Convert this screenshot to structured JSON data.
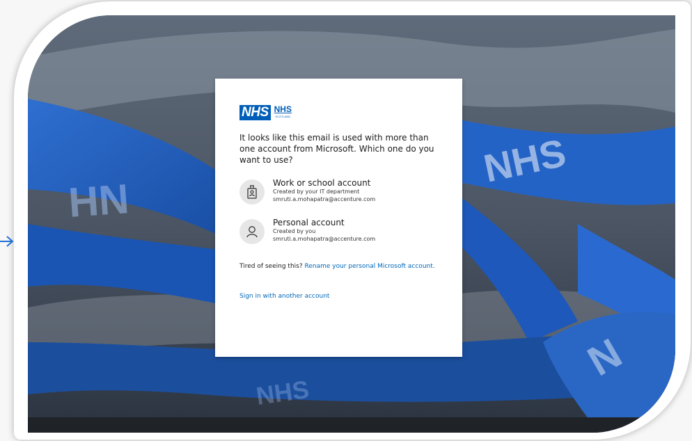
{
  "logo": {
    "nhs_text": "NHS",
    "scotland_nhs_text": "NHS",
    "scotland_sub_text": "SCOTLAND"
  },
  "card": {
    "question": "It looks like this email is used with more than one account from Microsoft. Which one do you want to use?",
    "accounts": [
      {
        "name": "Work or school account",
        "subtitle": "Created by your IT department",
        "email": "smruti.a.mohapatra@accenture.com",
        "icon": "id-badge-icon"
      },
      {
        "name": "Personal account",
        "subtitle": "Created by you",
        "email": "smruti.a.mohapatra@accenture.com",
        "icon": "person-icon"
      }
    ],
    "tired_text": "Tired of seeing this?",
    "rename_link": "Rename your personal Microsoft account.",
    "sign_in_other": "Sign in with another account"
  },
  "colors": {
    "nhs_blue": "#005eb8",
    "link_blue": "#0067b8",
    "lanyard_blue": "#1f5fc8"
  }
}
